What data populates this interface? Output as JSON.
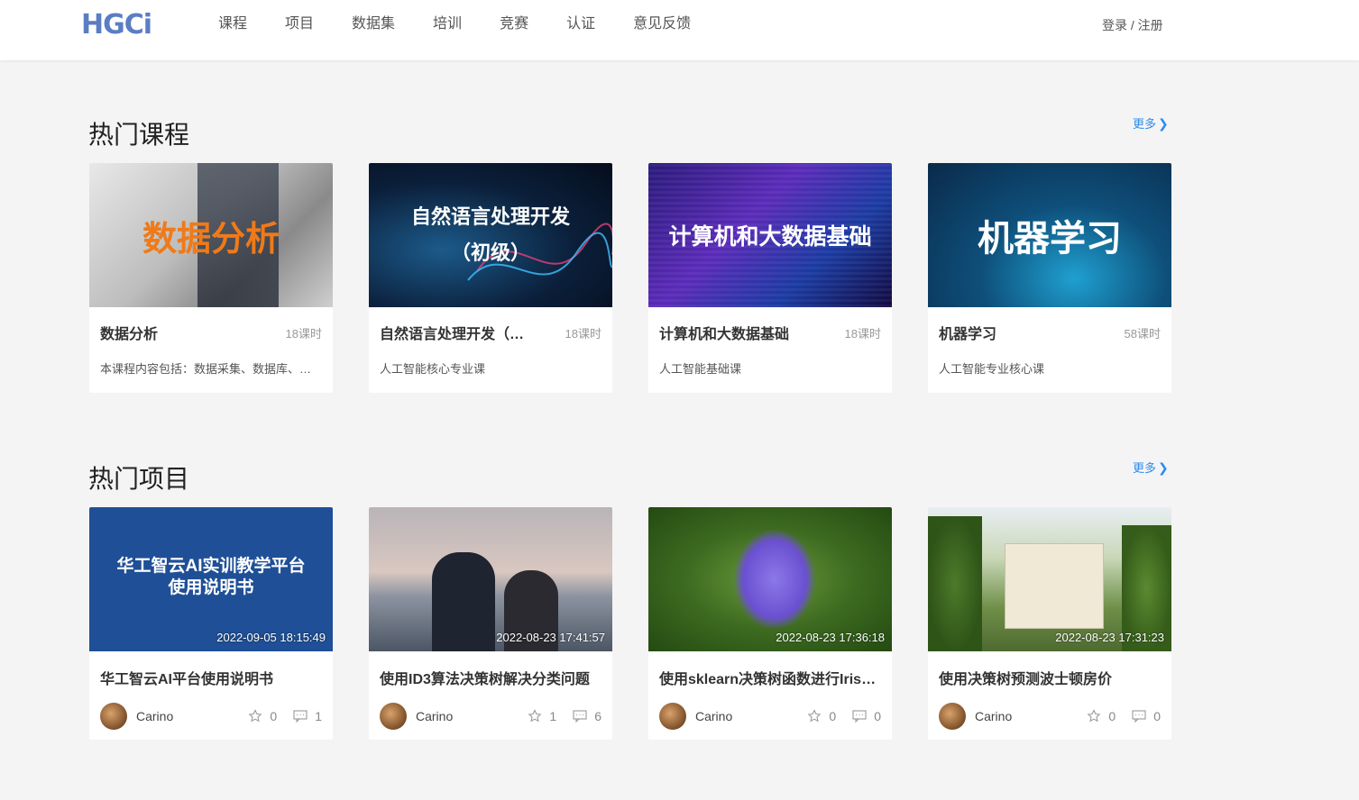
{
  "header": {
    "logo": "HGCi",
    "nav": [
      "课程",
      "项目",
      "数据集",
      "培训",
      "竞赛",
      "认证",
      "意见反馈"
    ],
    "login": "登录 / 注册"
  },
  "courses_section": {
    "title": "热门课程",
    "more": "更多",
    "items": [
      {
        "thumb_text": "数据分析",
        "name": "数据分析",
        "hours": "18课时",
        "desc": "本课程内容包括：数据采集、数据库、数据预处理、数据可视化"
      },
      {
        "thumb_text": "自然语言处理开发\n（初级）",
        "name": "自然语言处理开发（初级）",
        "hours": "18课时",
        "desc": "人工智能核心专业课"
      },
      {
        "thumb_text": "计算机和大数据基础",
        "name": "计算机和大数据基础",
        "hours": "18课时",
        "desc": "人工智能基础课"
      },
      {
        "thumb_text": "机器学习",
        "name": "机器学习",
        "hours": "58课时",
        "desc": "人工智能专业核心课"
      }
    ]
  },
  "projects_section": {
    "title": "热门项目",
    "more": "更多",
    "items": [
      {
        "thumb_text": "华工智云AI实训教学平台\n使用说明书",
        "date": "2022-09-05 18:15:49",
        "name": "华工智云AI平台使用说明书",
        "author": "Carino",
        "stars": "0",
        "comments": "1"
      },
      {
        "thumb_text": "",
        "date": "2022-08-23 17:41:57",
        "name": "使用ID3算法决策树解决分类问题",
        "author": "Carino",
        "stars": "1",
        "comments": "6"
      },
      {
        "thumb_text": "",
        "date": "2022-08-23 17:36:18",
        "name": "使用sklearn决策树函数进行Iris分类",
        "author": "Carino",
        "stars": "0",
        "comments": "0"
      },
      {
        "thumb_text": "",
        "date": "2022-08-23 17:31:23",
        "name": "使用决策树预测波士顿房价",
        "author": "Carino",
        "stars": "0",
        "comments": "0"
      }
    ]
  }
}
